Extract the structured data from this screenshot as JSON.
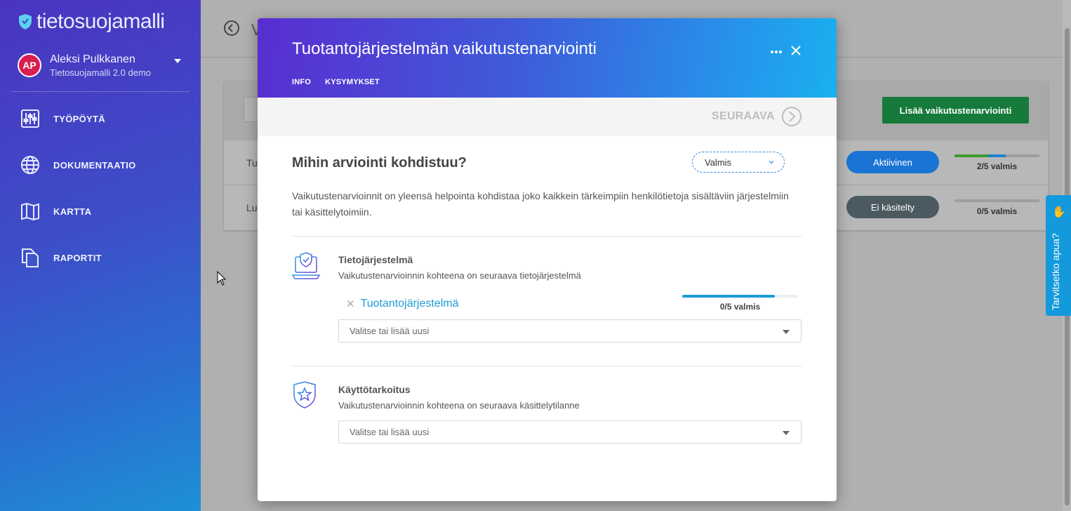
{
  "app": {
    "logo_text": "tietosuojamalli",
    "user": {
      "initials": "AP",
      "name": "Aleksi Pulkkanen",
      "org": "Tietosuojamalli 2.0 demo"
    },
    "nav": [
      {
        "label": "TYÖPÖYTÄ",
        "icon": "sliders-icon"
      },
      {
        "label": "DOKUMENTAATIO",
        "icon": "globe-icon"
      },
      {
        "label": "KARTTA",
        "icon": "map-icon"
      },
      {
        "label": "RAPORTIT",
        "icon": "documents-icon"
      }
    ]
  },
  "background": {
    "title_initial": "V",
    "add_button": "Lisää vaikutustenarviointi",
    "rows": [
      {
        "name_fragment": "Tu",
        "status": "Aktiivinen",
        "status_color": "#1a74d4",
        "progress_label": "2/5 valmis",
        "progress": 0.6
      },
      {
        "name_fragment": "Lu",
        "status": "Ei käsitelty",
        "status_color": "#4a5a60",
        "progress_label": "0/5 valmis",
        "progress": 0
      }
    ],
    "help_tab": "Tarvitsetko apua?"
  },
  "modal": {
    "title": "Tuotantojärjestelmän vaikutustenarviointi",
    "tabs": [
      "INFO",
      "KYSYMYKSET"
    ],
    "next_label": "SEURAAVA",
    "section_title": "Mihin arviointi kohdistuu?",
    "status_value": "Valmis",
    "intro": "Vaikutustenarvioinnit on yleensä helpointa kohdistaa joko kaikkein tärkeimpiin henkilötietoja sisältäviin järjestelmiin tai käsittelytoimiin.",
    "questions": [
      {
        "title": "Tietojärjestelmä",
        "description": "Vaikutustenarvioinnin kohteena on seuraava tietojärjestelmä",
        "selected": {
          "name": "Tuotantojärjestelmä",
          "progress_label": "0/5 valmis",
          "progress": 0.8
        },
        "placeholder": "Valitse tai lisää uusi",
        "icon": "laptop-shield-icon"
      },
      {
        "title": "Käyttötarkoitus",
        "description": "Vaikutustenarvioinnin kohteena on seuraava käsittelytilanne",
        "placeholder": "Valitse tai lisää uusi",
        "icon": "shield-star-icon"
      }
    ]
  }
}
